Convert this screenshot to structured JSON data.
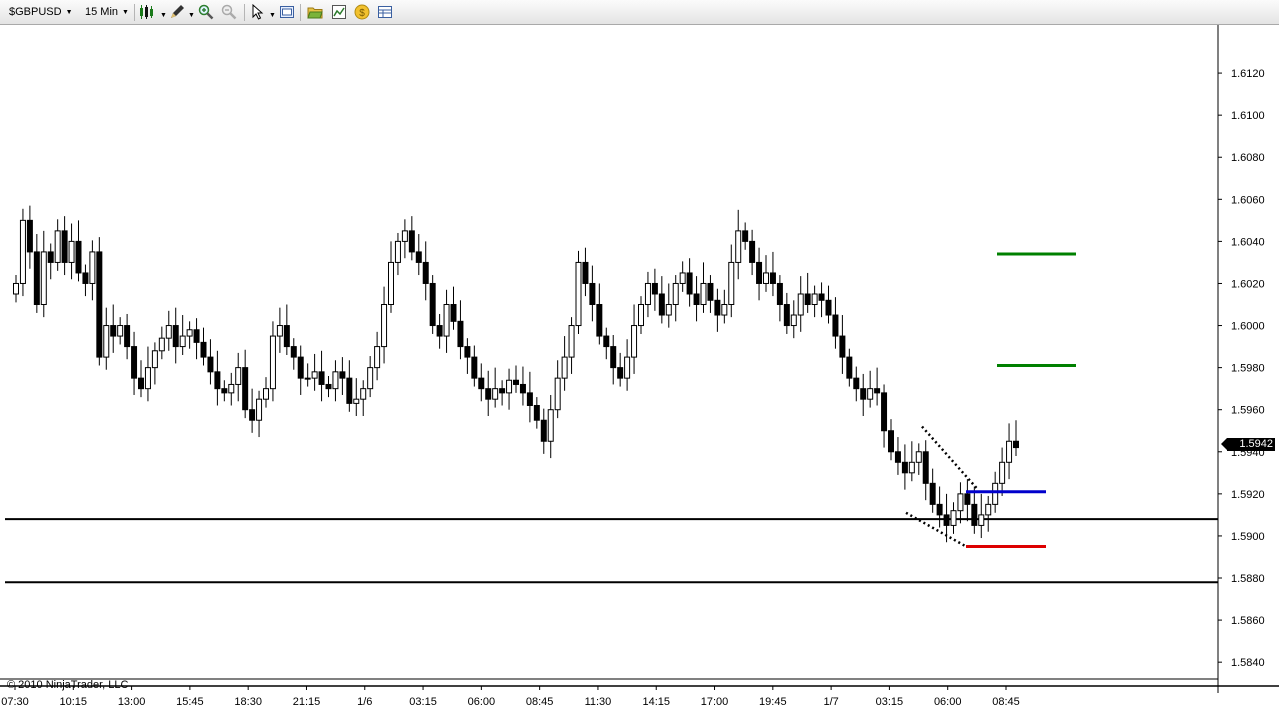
{
  "toolbar": {
    "instrument": "$GBPUSD",
    "interval": "15 Min",
    "icons": [
      "candlestick-style-icon",
      "drawing-pencil-icon",
      "zoom-in-icon",
      "zoom-out-icon",
      "cursor-arrow-icon",
      "properties-icon",
      "folder-icon",
      "chart-data-icon",
      "currency-coin-icon",
      "data-box-icon"
    ]
  },
  "chart": {
    "copyright": "© 2010 NinjaTrader, LLC",
    "last_price": "1.5942"
  },
  "colors": {
    "bull_candle": "#ffffff",
    "bear_candle": "#000000",
    "target_line": "#008000",
    "entry_line": "#0000cc",
    "stop_line": "#dd0000"
  },
  "chart_data": {
    "type": "candlestick",
    "y_ticks": [
      "1.6120",
      "1.6100",
      "1.6080",
      "1.6060",
      "1.6040",
      "1.6020",
      "1.6000",
      "1.5980",
      "1.5960",
      "1.5940",
      "1.5920",
      "1.5900",
      "1.5880",
      "1.5860",
      "1.5840"
    ],
    "x_ticks": [
      "07:30",
      "10:15",
      "13:00",
      "15:45",
      "18:30",
      "21:15",
      "1/6",
      "03:15",
      "06:00",
      "08:45",
      "11:30",
      "14:15",
      "17:00",
      "19:45",
      "1/7",
      "03:15",
      "06:00",
      "08:45"
    ],
    "ylim": [
      1.5832,
      1.614
    ],
    "horizontal_lines": [
      1.5908,
      1.5878
    ],
    "levels": {
      "target_high": 1.6034,
      "target_low": 1.5981,
      "entry": 1.5921,
      "stop": 1.5895
    },
    "wedge": {
      "upper": [
        [
          1.5952,
          1.5922
        ]
      ],
      "lower": [
        [
          1.5911,
          1.5895
        ]
      ]
    },
    "closes": [
      1.602,
      1.605,
      1.6035,
      1.601,
      1.6035,
      1.603,
      1.6045,
      1.603,
      1.604,
      1.6025,
      1.602,
      1.6035,
      1.5985,
      1.6,
      1.5995,
      1.6,
      1.599,
      1.5975,
      1.597,
      1.598,
      1.5988,
      1.5994,
      1.6,
      1.599,
      1.5995,
      1.5998,
      1.5992,
      1.5985,
      1.5978,
      1.597,
      1.5968,
      1.5972,
      1.598,
      1.596,
      1.5955,
      1.5965,
      1.597,
      1.5995,
      1.6,
      1.599,
      1.5985,
      1.5975,
      1.5975,
      1.5978,
      1.5972,
      1.597,
      1.5978,
      1.5975,
      1.5963,
      1.5965,
      1.597,
      1.598,
      1.599,
      1.601,
      1.603,
      1.604,
      1.6045,
      1.6035,
      1.603,
      1.602,
      1.6,
      1.5995,
      1.601,
      1.6002,
      1.599,
      1.5985,
      1.5975,
      1.597,
      1.5965,
      1.597,
      1.5968,
      1.5974,
      1.5972,
      1.5968,
      1.5962,
      1.5955,
      1.5945,
      1.596,
      1.5975,
      1.5985,
      1.6,
      1.603,
      1.602,
      1.601,
      1.5995,
      1.599,
      1.598,
      1.5975,
      1.5985,
      1.6,
      1.601,
      1.602,
      1.6015,
      1.6005,
      1.601,
      1.602,
      1.6025,
      1.6015,
      1.601,
      1.602,
      1.6012,
      1.6005,
      1.601,
      1.603,
      1.6045,
      1.604,
      1.603,
      1.602,
      1.6025,
      1.602,
      1.601,
      1.6,
      1.6005,
      1.6015,
      1.601,
      1.6015,
      1.6012,
      1.6005,
      1.5995,
      1.5985,
      1.5975,
      1.597,
      1.5965,
      1.597,
      1.5968,
      1.595,
      1.594,
      1.5935,
      1.593,
      1.5935,
      1.594,
      1.5925,
      1.5915,
      1.591,
      1.5905,
      1.5912,
      1.592,
      1.5915,
      1.5905,
      1.591,
      1.5915,
      1.5925,
      1.5935,
      1.5945,
      1.5942
    ]
  }
}
